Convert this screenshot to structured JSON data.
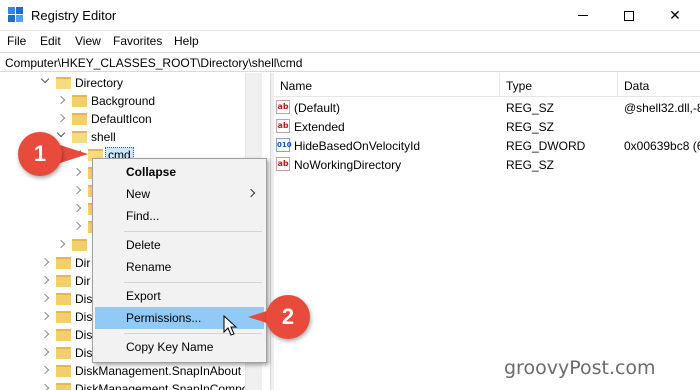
{
  "window": {
    "title": "Registry Editor",
    "minimize": "",
    "maximize": "",
    "close": "✕"
  },
  "menu": [
    "File",
    "Edit",
    "View",
    "Favorites",
    "Help"
  ],
  "address": "Computer\\HKEY_CLASSES_ROOT\\Directory\\shell\\cmd",
  "tree": {
    "directory": "Directory",
    "background": "Background",
    "defaulticon": "DefaultIcon",
    "shell": "shell",
    "cmd": "cmd",
    "dir_partial_1": "Dir",
    "dir_partial_2": "Dir",
    "disk_1": "Disk",
    "disk_2": "Disk",
    "disk_3": "Disk",
    "disk_4": "Disk",
    "diskmgmt_about": "DiskManagement.SnapInAbout",
    "diskmgmt_compo": "DiskManagement.SnapInCompo"
  },
  "list": {
    "headers": {
      "name": "Name",
      "type": "Type",
      "data": "Data"
    },
    "rows": [
      {
        "name": "(Default)",
        "type": "REG_SZ",
        "data": "@shell32.dll,-8",
        "icon": "ab"
      },
      {
        "name": "Extended",
        "type": "REG_SZ",
        "data": "",
        "icon": "ab"
      },
      {
        "name": "HideBasedOnVelocityId",
        "type": "REG_DWORD",
        "data": "0x00639bc8 (6",
        "icon": "010"
      },
      {
        "name": "NoWorkingDirectory",
        "type": "REG_SZ",
        "data": "",
        "icon": "ab"
      }
    ]
  },
  "context_menu": {
    "collapse": "Collapse",
    "new": "New",
    "find": "Find...",
    "delete": "Delete",
    "rename": "Rename",
    "export": "Export",
    "permissions": "Permissions...",
    "copy_key_name": "Copy Key Name"
  },
  "callouts": {
    "one": "1",
    "two": "2"
  },
  "watermark": "groovyPost.com",
  "colors": {
    "callout": "#e84a3c",
    "highlight": "#91c9f7",
    "selection": "#cce8ff"
  }
}
